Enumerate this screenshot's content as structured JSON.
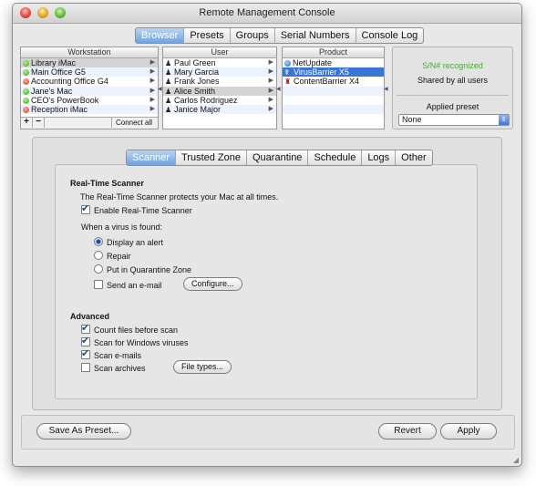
{
  "window": {
    "title": "Remote Management Console"
  },
  "top_tabs": [
    {
      "label": "Browser",
      "active": true
    },
    {
      "label": "Presets",
      "active": false
    },
    {
      "label": "Groups",
      "active": false
    },
    {
      "label": "Serial Numbers",
      "active": false
    },
    {
      "label": "Console Log",
      "active": false
    }
  ],
  "workstation": {
    "header": "Workstation",
    "items": [
      {
        "label": "Library iMac",
        "status": "green",
        "selected": "gray"
      },
      {
        "label": "Main Office G5",
        "status": "green",
        "selected": ""
      },
      {
        "label": "Accounting Office G4",
        "status": "red",
        "selected": ""
      },
      {
        "label": "Jane's Mac",
        "status": "green",
        "selected": ""
      },
      {
        "label": "CEO's PowerBook",
        "status": "green",
        "selected": ""
      },
      {
        "label": "Reception iMac",
        "status": "red",
        "selected": ""
      }
    ],
    "add_label": "+",
    "remove_label": "−",
    "connect_label": "Connect all"
  },
  "user": {
    "header": "User",
    "items": [
      {
        "label": "Paul Green",
        "selected": ""
      },
      {
        "label": "Mary Garcia",
        "selected": ""
      },
      {
        "label": "Frank Jones",
        "selected": ""
      },
      {
        "label": "Alice Smith",
        "selected": "gray"
      },
      {
        "label": "Carlos Rodriguez",
        "selected": ""
      },
      {
        "label": "Janice Major",
        "selected": ""
      }
    ]
  },
  "product": {
    "header": "Product",
    "items": [
      {
        "label": "NetUpdate",
        "selected": ""
      },
      {
        "label": "VirusBarrier X5",
        "selected": "blue"
      },
      {
        "label": "ContentBarrier X4",
        "selected": ""
      }
    ]
  },
  "info": {
    "sn_status": "S/N# recognized",
    "shared": "Shared by all users",
    "preset_label": "Applied preset",
    "preset_value": "None"
  },
  "sub_tabs": [
    {
      "label": "Scanner",
      "active": true
    },
    {
      "label": "Trusted Zone",
      "active": false
    },
    {
      "label": "Quarantine",
      "active": false
    },
    {
      "label": "Schedule",
      "active": false
    },
    {
      "label": "Logs",
      "active": false
    },
    {
      "label": "Other",
      "active": false
    }
  ],
  "scanner": {
    "realtime_heading": "Real-Time Scanner",
    "realtime_desc": "The Real-Time Scanner protects your Mac at all times.",
    "enable_label": "Enable Real-Time Scanner",
    "enable_checked": true,
    "virus_found_label": "When a virus is found:",
    "actions": [
      {
        "label": "Display an alert",
        "selected": true
      },
      {
        "label": "Repair",
        "selected": false
      },
      {
        "label": "Put in Quarantine Zone",
        "selected": false
      }
    ],
    "email_label": "Send an e-mail",
    "email_checked": false,
    "configure_label": "Configure...",
    "advanced_heading": "Advanced",
    "advanced": [
      {
        "label": "Count files before scan",
        "checked": true
      },
      {
        "label": "Scan for Windows viruses",
        "checked": true
      },
      {
        "label": "Scan e-mails",
        "checked": true
      },
      {
        "label": "Scan archives",
        "checked": false
      }
    ],
    "file_types_label": "File types..."
  },
  "footer": {
    "save_preset": "Save As Preset...",
    "revert": "Revert",
    "apply": "Apply"
  },
  "colors": {
    "accent": "#3875d7",
    "sn_ok": "#4aa63c"
  }
}
